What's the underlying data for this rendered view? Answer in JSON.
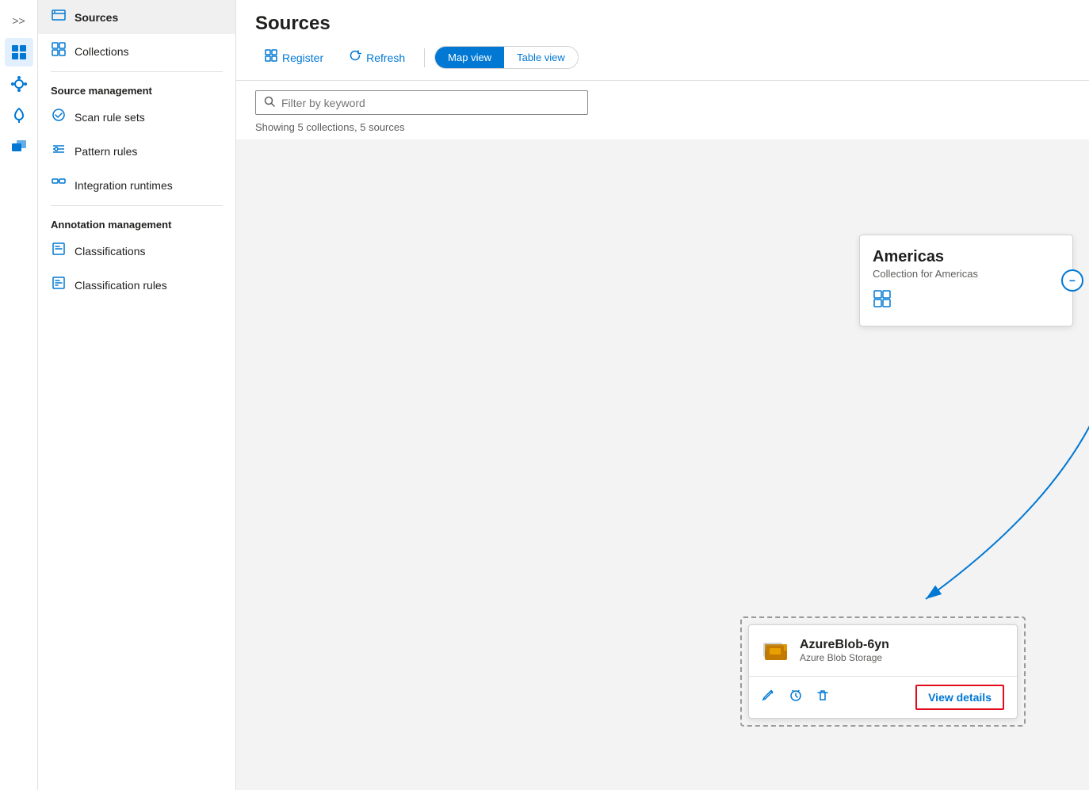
{
  "iconRail": {
    "collapseTitle": ">>",
    "icons": [
      {
        "name": "data-catalog-icon",
        "symbol": "🗄",
        "active": true
      },
      {
        "name": "connections-icon",
        "symbol": "⚙",
        "active": false
      },
      {
        "name": "insights-icon",
        "symbol": "💡",
        "active": false
      },
      {
        "name": "tools-icon",
        "symbol": "🧰",
        "active": false
      }
    ]
  },
  "sidebar": {
    "items": [
      {
        "label": "Sources",
        "name": "sources",
        "active": true,
        "icon": "🗃"
      },
      {
        "label": "Collections",
        "name": "collections",
        "active": false,
        "icon": "⊞"
      }
    ],
    "sourceManagement": {
      "header": "Source management",
      "items": [
        {
          "label": "Scan rule sets",
          "name": "scan-rule-sets",
          "icon": "⊛"
        },
        {
          "label": "Pattern rules",
          "name": "pattern-rules",
          "icon": "≡●"
        },
        {
          "label": "Integration runtimes",
          "name": "integration-runtimes",
          "icon": "⊞"
        }
      ]
    },
    "annotationManagement": {
      "header": "Annotation management",
      "items": [
        {
          "label": "Classifications",
          "name": "classifications",
          "icon": "⊡"
        },
        {
          "label": "Classification rules",
          "name": "classification-rules",
          "icon": "⊡"
        }
      ]
    }
  },
  "main": {
    "title": "Sources",
    "toolbar": {
      "register_label": "Register",
      "refresh_label": "Refresh",
      "mapview_label": "Map view",
      "tableview_label": "Table view"
    },
    "filter": {
      "placeholder": "Filter by keyword"
    },
    "showing": "Showing 5 collections, 5 sources",
    "americasCard": {
      "title": "Americas",
      "subtitle": "Collection for Americas"
    },
    "blobCard": {
      "name": "AzureBlob-6yn",
      "type": "Azure Blob Storage",
      "viewDetails": "View details"
    }
  }
}
